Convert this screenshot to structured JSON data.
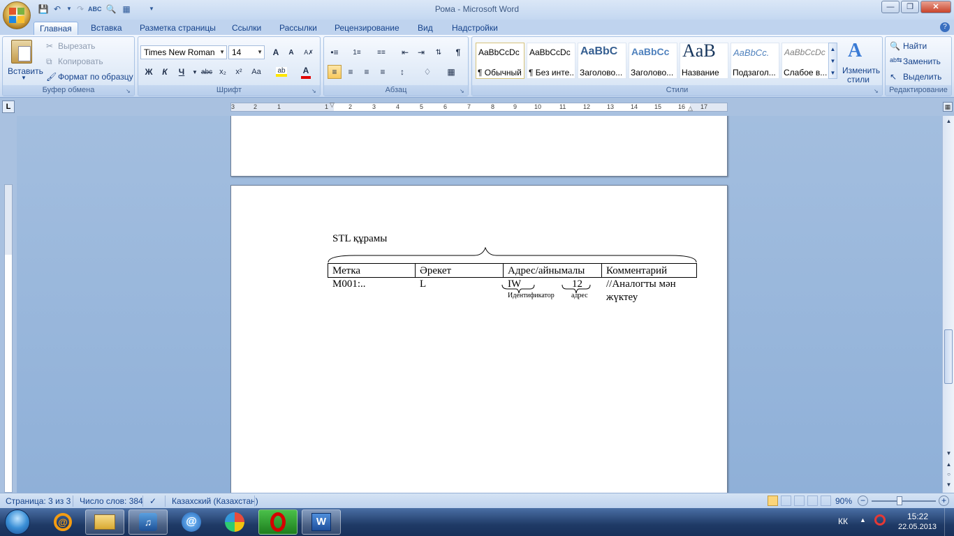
{
  "window": {
    "title": "Рома - Microsoft Word"
  },
  "tabs": [
    "Главная",
    "Вставка",
    "Разметка страницы",
    "Ссылки",
    "Рассылки",
    "Рецензирование",
    "Вид",
    "Надстройки"
  ],
  "ribbon": {
    "clipboard": {
      "label": "Буфер обмена",
      "paste": "Вставить",
      "cut": "Вырезать",
      "copy": "Копировать",
      "format_painter": "Формат по образцу"
    },
    "font": {
      "label": "Шрифт",
      "name": "Times New Roman",
      "size": "14",
      "bold": "Ж",
      "italic": "К",
      "underline": "Ч",
      "strike": "abc",
      "subscript": "x₂",
      "superscript": "x²",
      "case": "Aa",
      "grow": "A",
      "shrink": "A"
    },
    "paragraph": {
      "label": "Абзац"
    },
    "styles": {
      "label": "Стили",
      "items": [
        {
          "preview": "AaBbCcDc",
          "name": "¶ Обычный"
        },
        {
          "preview": "AaBbCcDc",
          "name": "¶ Без инте..."
        },
        {
          "preview": "AaBbC",
          "name": "Заголово..."
        },
        {
          "preview": "AaBbCc",
          "name": "Заголово..."
        },
        {
          "preview": "AaB",
          "name": "Название"
        },
        {
          "preview": "AaBbCc.",
          "name": "Подзагол..."
        },
        {
          "preview": "AaBbCcDc",
          "name": "Слабое в..."
        }
      ],
      "change_styles_1": "Изменить",
      "change_styles_2": "стили"
    },
    "editing": {
      "label": "Редактирование",
      "find": "Найти",
      "replace": "Заменить",
      "select": "Выделить"
    }
  },
  "ruler": {
    "h_numbers": [
      "3",
      "2",
      "1",
      "1",
      "2",
      "3",
      "4",
      "5",
      "6",
      "7",
      "8",
      "9",
      "10",
      "11",
      "12",
      "13",
      "14",
      "15",
      "16",
      "17"
    ]
  },
  "document": {
    "heading": "STL құрамы",
    "table": {
      "headers": [
        "Метка",
        "Әрекет",
        "Адрес/айнымалы",
        "Комментарий"
      ],
      "row": {
        "label": "M001:..",
        "action": "L",
        "address_id": "IW",
        "address_num": "12",
        "comment_1": "//Аналогты мән",
        "comment_2": "жүктеу"
      },
      "annotation_id": "Идентификатор",
      "annotation_addr": "адрес"
    }
  },
  "status": {
    "page": "Страница: 3 из 3",
    "words": "Число слов: 384",
    "language": "Казахский (Казахстан)",
    "zoom": "90%"
  },
  "taskbar": {
    "lang": "КК",
    "time": "15:22",
    "date": "22.05.2013"
  }
}
